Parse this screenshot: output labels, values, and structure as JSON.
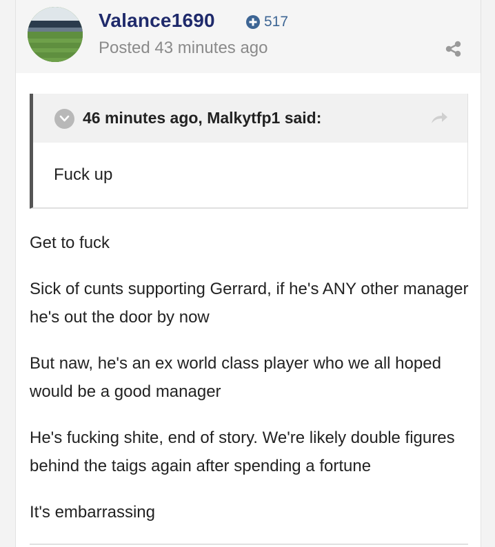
{
  "post": {
    "author": "Valance1690",
    "reputation": "517",
    "posted": "Posted 43 minutes ago",
    "quote": {
      "citation": "46 minutes ago, Malkytfp1 said:",
      "text": "Fuck up"
    },
    "paragraphs": [
      "Get to fuck",
      "Sick of cunts supporting Gerrard, if he's ANY other manager he's out the door by now",
      "But naw, he's an ex world class player who we all hoped would be a good manager",
      "He's fucking shite, end of story. We're likely double figures behind the taigs again after spending a fortune",
      "It's embarrassing"
    ]
  },
  "icons": {
    "reputation": "plus-circle-icon",
    "share": "share-icon",
    "quote_toggle": "chevron-down-icon",
    "quote_jump": "share-arrow-icon"
  },
  "colors": {
    "username": "#1f2a6b",
    "reputation": "#3d6594",
    "muted": "#8a8a8a",
    "header_bg": "#f5f5f5",
    "quote_bar": "#555555"
  }
}
